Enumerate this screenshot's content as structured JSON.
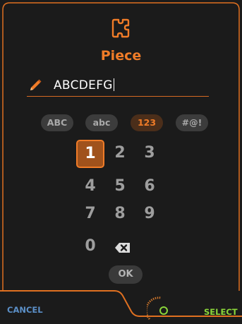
{
  "dialog": {
    "title": "Piece",
    "title_icon": "puzzle-piece-icon",
    "input_icon": "pencil-icon",
    "input_value": "ABCDEFG"
  },
  "modes": [
    {
      "label": "ABC",
      "active": false
    },
    {
      "label": "abc",
      "active": false
    },
    {
      "label": "123",
      "active": true
    },
    {
      "label": "#@!",
      "active": false
    }
  ],
  "keypad": {
    "keys": [
      "1",
      "2",
      "3",
      "4",
      "5",
      "6",
      "7",
      "8",
      "9",
      "0"
    ],
    "selected": "1",
    "backspace_icon": "backspace-icon",
    "ok_label": "OK"
  },
  "footer": {
    "cancel_label": "CANCEL",
    "select_label": "SELECT",
    "knob_icon": "rotary-knob-icon"
  },
  "colors": {
    "accent": "#f07c28",
    "cancel": "#5b8fc7",
    "select": "#8bd63a",
    "panel": "#1b1b1b"
  }
}
